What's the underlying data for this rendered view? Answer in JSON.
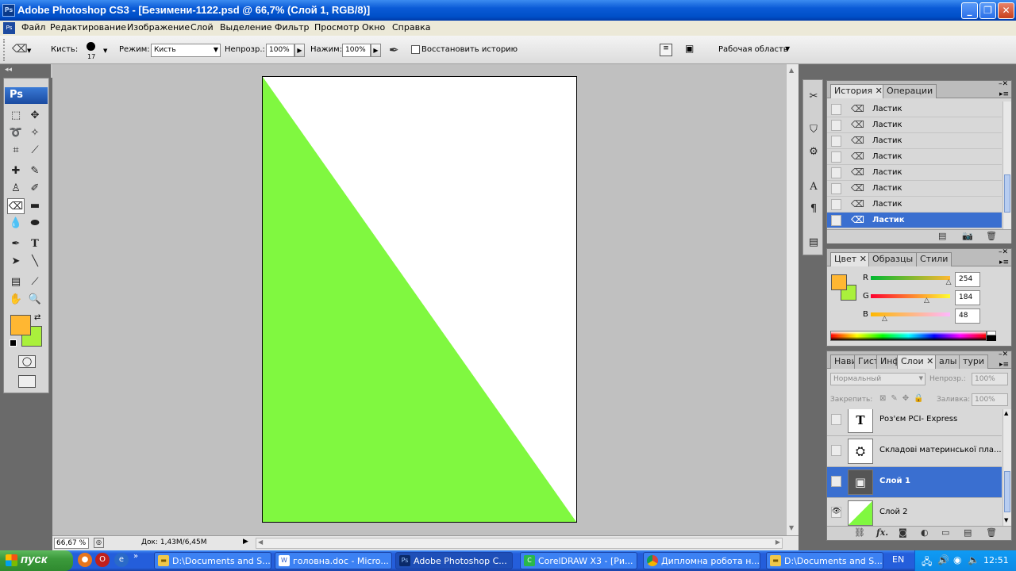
{
  "window": {
    "icon": "Ps",
    "title": "Adobe Photoshop CS3 - [Безимени-1122.psd @ 66,7% (Слой 1, RGB/8)]",
    "controls": [
      "minimize",
      "restore",
      "close"
    ]
  },
  "menu": {
    "items": [
      "Файл",
      "Редактирование",
      "Изображение",
      "Слой",
      "Выделение",
      "Фильтр",
      "Просмотр",
      "Окно",
      "Справка"
    ]
  },
  "options_bar": {
    "brush_label": "Кисть:",
    "brush_size": "17",
    "mode_label": "Режим:",
    "mode_value": "Кисть",
    "opacity_label": "Непрозр.:",
    "opacity_value": "100%",
    "flow_label": "Нажим:",
    "flow_value": "100%",
    "restore_history_label": "Восстановить историю",
    "workspace_label": "Рабочая область"
  },
  "toolbox": {
    "logo": "Ps",
    "foreground_color": "#ffb732",
    "background_color": "#aaf03c"
  },
  "document": {
    "fill_color": "#80f840",
    "background": "#ffffff"
  },
  "status": {
    "zoom": "66,67 %",
    "doc_info": "Док: 1,43M/6,45M"
  },
  "history_panel": {
    "tabs": [
      "История",
      "Операции"
    ],
    "items": [
      "Ластик",
      "Ластик",
      "Ластик",
      "Ластик",
      "Ластик",
      "Ластик",
      "Ластик",
      "Ластик"
    ],
    "selected_index": 7
  },
  "color_panel": {
    "tabs": [
      "Цвет",
      "Образцы",
      "Стили"
    ],
    "r_label": "R",
    "g_label": "G",
    "b_label": "B",
    "r": "254",
    "g": "184",
    "b": "48",
    "r_level": 0.996,
    "g_level": 0.72,
    "b_level": 0.19,
    "fg": "#ffb732",
    "bg": "#aaf03c"
  },
  "layers_panel": {
    "tabs": [
      "Нави",
      "Гист",
      "Инф",
      "Слои",
      "алы",
      "тури"
    ],
    "blend_mode": "Нормальный",
    "opacity_label": "Непрозр.:",
    "opacity_value": "100%",
    "lock_label": "Закрепить:",
    "fill_label": "Заливка:",
    "fill_value": "100%",
    "layers": [
      {
        "name": "Роз'єм PCI- Express",
        "thumb": "T",
        "visible": false,
        "selected": false
      },
      {
        "name": "Складові материнської пла...",
        "thumb": "img",
        "visible": false,
        "selected": false
      },
      {
        "name": "Слой 1",
        "thumb": "img",
        "visible": false,
        "selected": true
      },
      {
        "name": "Слой 2",
        "thumb": "green",
        "visible": true,
        "selected": false
      }
    ],
    "fx_label": "fx."
  },
  "taskbar": {
    "start_label": "пуск",
    "buttons": [
      {
        "label": "D:\\Documents and S...",
        "icon": "folder-icon"
      },
      {
        "label": "головна.doc - Micro...",
        "icon": "word-icon"
      },
      {
        "label": "Adobe Photoshop C...",
        "icon": "photoshop-icon",
        "active": true
      },
      {
        "label": "CorelDRAW X3 - [Ри...",
        "icon": "corel-icon"
      },
      {
        "label": "Дипломна робота н...",
        "icon": "chrome-icon"
      },
      {
        "label": "D:\\Documents and S...",
        "icon": "folder-icon"
      }
    ],
    "language": "EN",
    "clock": "12:51"
  }
}
